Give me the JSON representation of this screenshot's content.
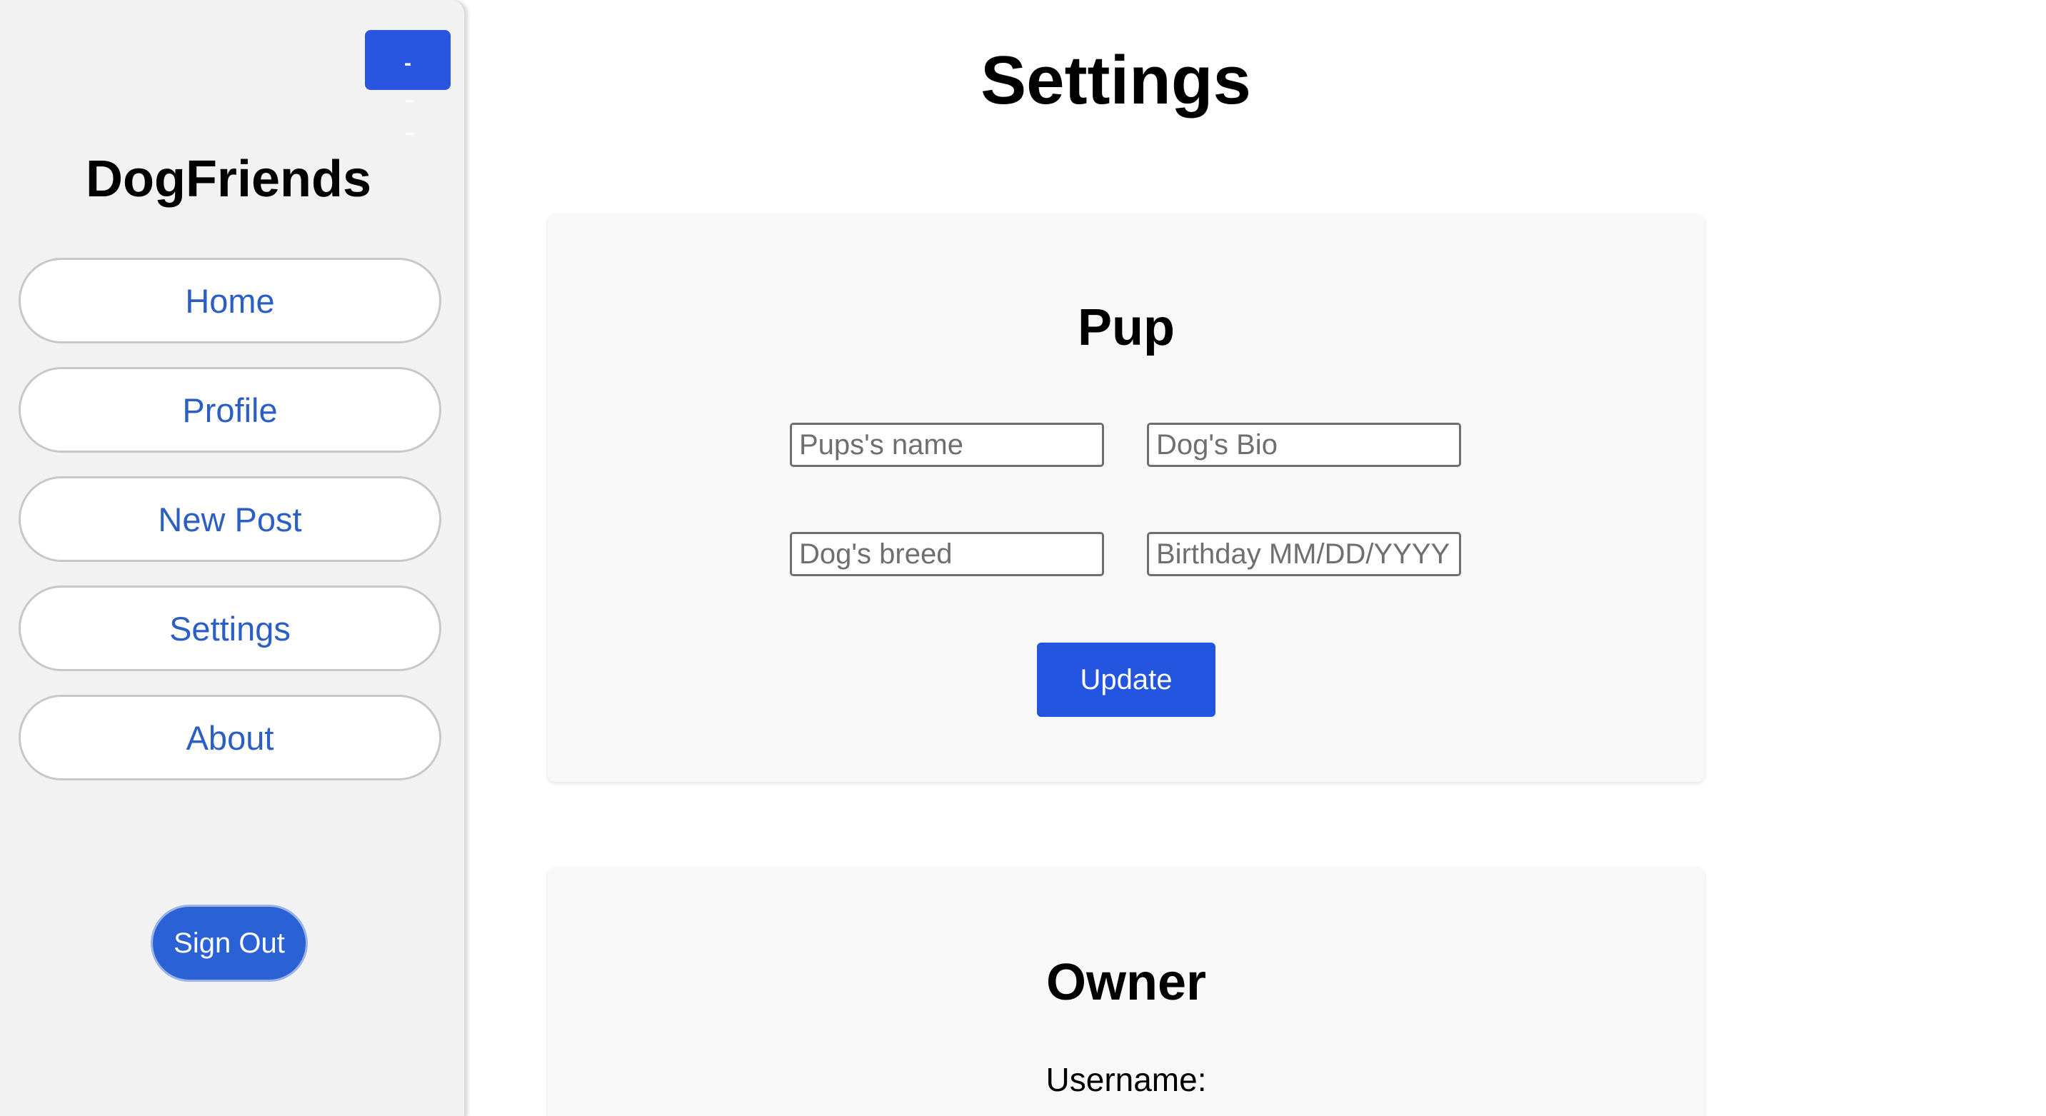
{
  "sidebar": {
    "collapse_label": "-",
    "brand": "DogFriends",
    "nav": [
      {
        "label": "Home"
      },
      {
        "label": "Profile"
      },
      {
        "label": "New Post"
      },
      {
        "label": "Settings"
      },
      {
        "label": "About"
      }
    ],
    "signout_label": "Sign Out"
  },
  "main": {
    "title": "Settings",
    "pup": {
      "title": "Pup",
      "name_placeholder": "Pups's name",
      "bio_placeholder": "Dog's Bio",
      "breed_placeholder": "Dog's breed",
      "birthday_placeholder": "Birthday MM/DD/YYYY",
      "update_label": "Update"
    },
    "owner": {
      "title": "Owner",
      "username_label": "Username:"
    }
  },
  "colors": {
    "accent": "#2455e0",
    "nav_text": "#2b5fc4",
    "sidebar_bg": "#f2f2f2",
    "card_bg": "#f8f8f8"
  }
}
